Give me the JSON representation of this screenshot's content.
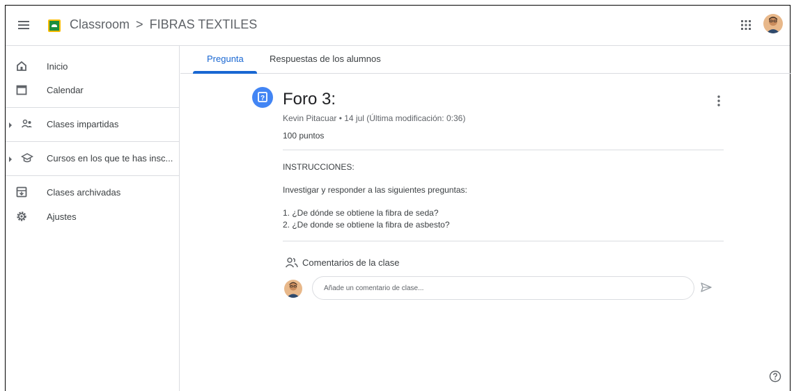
{
  "header": {
    "app_name": "Classroom",
    "separator": ">",
    "class_name": "FIBRAS TEXTILES",
    "menu_icon": "hamburger-menu-icon",
    "apps_icon": "google-apps-grid-icon",
    "avatar": "user-avatar"
  },
  "sidebar": {
    "items": [
      {
        "label": "Inicio",
        "icon": "home-icon"
      },
      {
        "label": "Calendar",
        "icon": "calendar-icon"
      },
      {
        "label": "Clases impartidas",
        "icon": "teacher-people-icon"
      },
      {
        "label": "Cursos en los que te has insc...",
        "icon": "graduation-cap-icon"
      },
      {
        "label": "Clases archivadas",
        "icon": "archive-icon"
      },
      {
        "label": "Ajustes",
        "icon": "gear-icon"
      }
    ]
  },
  "tabs": [
    {
      "label": "Pregunta",
      "active": true
    },
    {
      "label": "Respuestas de los alumnos",
      "active": false
    }
  ],
  "post": {
    "title": "Foro 3:",
    "meta": "Kevin Pitacuar • 14 jul (Última modificación: 0:36)",
    "points": "100 puntos",
    "instructions_heading": "INSTRUCCIONES:",
    "instructions_text": "Investigar y responder a las siguientes preguntas:",
    "questions": [
      "1. ¿De dónde se obtiene la fibra de seda?",
      "2. ¿De donde se obtiene la fibra de asbesto?"
    ]
  },
  "comments": {
    "label": "Comentarios de la clase",
    "placeholder": "Añade un comentario de clase...",
    "value": ""
  },
  "colors": {
    "accent_blue": "#1967d2",
    "question_icon_blue": "#4285f4",
    "classroom_green": "#1e8e3e",
    "classroom_yellow": "#fbbc04",
    "divider": "#dadce0"
  }
}
